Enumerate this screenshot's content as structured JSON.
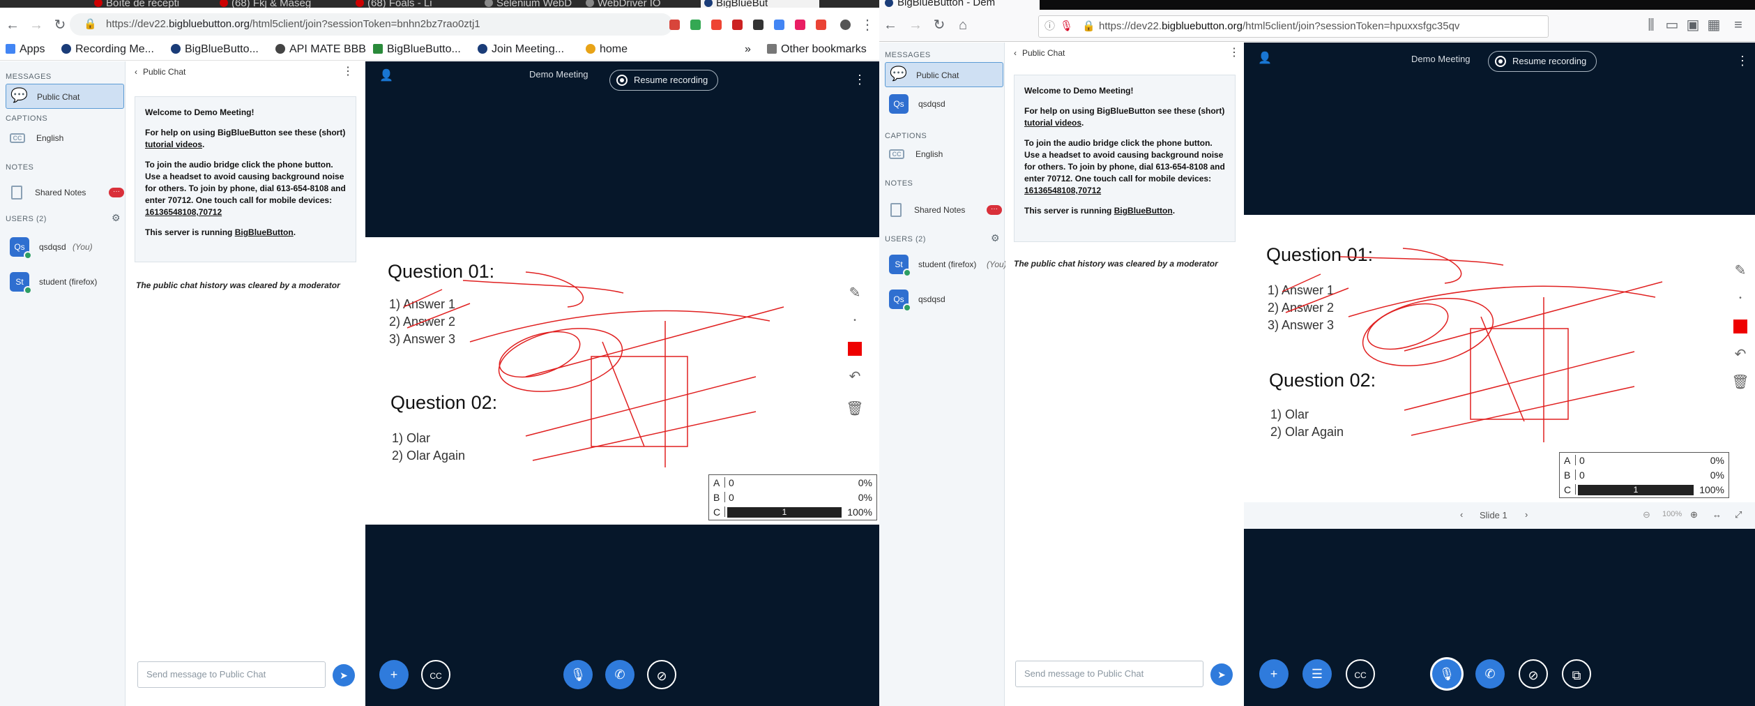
{
  "left": {
    "tabs": [
      "Boîte de récepti",
      "(68) Fkj & Maseg",
      "(68) Foals - Li",
      "Selenium WebD",
      "WebDriver IO",
      "BigBlueBut"
    ],
    "url_prefix": "https://dev22.",
    "url_host": "bigbluebutton.org",
    "url_path": "/html5client/join?sessionToken=bnhn2bz7rao0ztj1",
    "bookmarks": [
      "Apps",
      "Recording Me...",
      "BigBlueButto...",
      "API MATE BBB",
      "BigBlueButto...",
      "Join Meeting...",
      "home"
    ],
    "other_bookmarks": "Other bookmarks",
    "bookmarks_more": "»",
    "userlist": {
      "messages_label": "MESSAGES",
      "public_chat": "Public Chat",
      "captions_label": "CAPTIONS",
      "captions_lang": "English",
      "notes_label": "NOTES",
      "shared_notes": "Shared Notes",
      "notes_badge": "···",
      "users_label": "USERS (2)",
      "users": [
        {
          "initials": "Qs",
          "name": "qsdqsd",
          "you": "(You)"
        },
        {
          "initials": "St",
          "name": "student (firefox)",
          "you": ""
        }
      ]
    },
    "chat": {
      "header": "Public Chat",
      "welcome_prefix": "Welcome to ",
      "welcome_meeting": "Demo Meeting",
      "welcome_suffix": "!",
      "help_text": "For help on using BigBlueButton see these (short) ",
      "help_link": "tutorial videos",
      "help_end": ".",
      "audio_text": "To join the audio bridge click the phone button. Use a headset to avoid causing background noise for others. To join by phone, dial 613-654-8108 and enter 70712. One touch call for mobile devices: ",
      "audio_link": "16136548108,70712",
      "running_text": "This server is running ",
      "running_link": "BigBlueButton",
      "running_end": ".",
      "cleared": "The public chat history was cleared by a moderator",
      "input_placeholder": "Send message to Public Chat"
    },
    "presentation": {
      "meeting_title": "Demo Meeting",
      "resume_recording": "Resume recording"
    }
  },
  "right": {
    "tab": "BigBlueButton - Dem",
    "url_prefix": "https://dev22.",
    "url_host": "bigbluebutton.org",
    "url_path": "/html5client/join?sessionToken=hpuxxsfgc35qv",
    "userlist": {
      "messages_label": "MESSAGES",
      "public_chat": "Public Chat",
      "chat_user": {
        "initials": "Qs",
        "name": "qsdqsd"
      },
      "captions_label": "CAPTIONS",
      "captions_lang": "English",
      "notes_label": "NOTES",
      "shared_notes": "Shared Notes",
      "notes_badge": "···",
      "users_label": "USERS (2)",
      "users": [
        {
          "initials": "St",
          "name": "student (firefox)",
          "you": "(You)"
        },
        {
          "initials": "Qs",
          "name": "qsdqsd",
          "you": ""
        }
      ]
    },
    "chat": {
      "header": "Public Chat",
      "input_placeholder": "Send message to Public Chat"
    },
    "presentation": {
      "meeting_title": "Demo Meeting",
      "resume_recording": "Resume recording",
      "slide_label": "Slide 1",
      "zoom": "100%"
    }
  },
  "slide": {
    "q1_title": "Question 01:",
    "q1_answers": [
      "1)   Answer 1",
      "2)   Answer 2",
      "3)   Answer 3"
    ],
    "q2_title": "Question 02:",
    "q2_answers": [
      "1)   Olar",
      "2)   Olar Again"
    ]
  },
  "poll": {
    "rows": [
      {
        "label": "A",
        "count": "0",
        "percent": "0%",
        "fraction": 0
      },
      {
        "label": "B",
        "count": "0",
        "percent": "0%",
        "fraction": 0
      },
      {
        "label": "C",
        "count": "1",
        "percent": "100%",
        "fraction": 1
      }
    ]
  },
  "colors": {
    "accent": "#2f7bdc",
    "presentation_bg": "#06172a",
    "annotation": "#e02020",
    "badge": "#d9303a",
    "online": "#2e9e63"
  }
}
